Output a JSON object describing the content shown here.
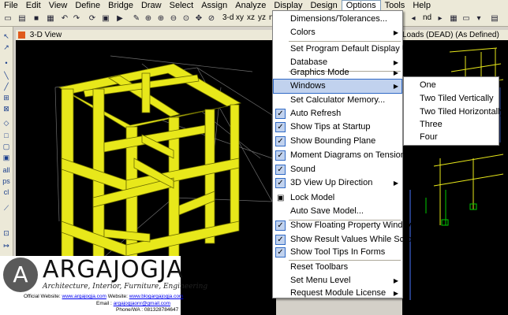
{
  "menu": [
    "File",
    "Edit",
    "View",
    "Define",
    "Bridge",
    "Draw",
    "Select",
    "Assign",
    "Analyze",
    "Display",
    "Design",
    "Options",
    "Tools",
    "Help"
  ],
  "active_menu": "Options",
  "toolbar": {
    "btn_3d": "3-d",
    "btn_xy": "xy",
    "btn_xz": "xz",
    "btn_yz": "yz",
    "btn_nv": "nv",
    "btn_nd": "nd"
  },
  "left_view": {
    "title": "3-D View"
  },
  "right_view": {
    "title": "Loads (DEAD) (As Defined)"
  },
  "options_menu": [
    {
      "label": "Dimensions/Tolerances...",
      "checked": false,
      "submenu": false
    },
    {
      "label": "Colors",
      "checked": false,
      "submenu": true
    },
    {
      "label": "Set Program Default Display Units...",
      "checked": false,
      "submenu": false
    },
    {
      "label": "Database",
      "checked": false,
      "submenu": true
    },
    {
      "label": "Graphics Mode",
      "checked": false,
      "submenu": true
    },
    {
      "label": "Windows",
      "checked": false,
      "submenu": true,
      "highlighted": true
    },
    {
      "label": "Set Calculator Memory...",
      "checked": false,
      "submenu": false
    },
    {
      "label": "Auto Refresh",
      "checked": true,
      "submenu": false
    },
    {
      "label": "Show Tips at Startup",
      "checked": true,
      "submenu": false
    },
    {
      "label": "Show Bounding Plane",
      "checked": true,
      "submenu": false
    },
    {
      "label": "Moment Diagrams on Tension Side",
      "checked": true,
      "submenu": false
    },
    {
      "label": "Sound",
      "checked": true,
      "submenu": false
    },
    {
      "label": "3D View Up Direction",
      "checked": true,
      "submenu": true
    },
    {
      "label": "Lock Model",
      "checked": false,
      "submenu": false,
      "icon": "lock-icon"
    },
    {
      "label": "Auto Save Model...",
      "checked": false,
      "submenu": false
    },
    {
      "label": "Show Floating Property Window",
      "checked": true,
      "submenu": false
    },
    {
      "label": "Show Result Values While Scrolling",
      "checked": true,
      "submenu": false
    },
    {
      "label": "Show Tool Tips In Forms",
      "checked": true,
      "submenu": false
    },
    {
      "label": "Reset Toolbars",
      "checked": false,
      "submenu": false
    },
    {
      "label": "Set Menu Level",
      "checked": false,
      "submenu": true
    },
    {
      "label": "Request Module License",
      "checked": false,
      "submenu": true
    }
  ],
  "windows_submenu": [
    "One",
    "Two Tiled Vertically",
    "Two Tiled Horizontally",
    "Three",
    "Four"
  ],
  "logo": {
    "letter": "A",
    "name": "ARGAJOGJA",
    "tagline": "Architecture, Interior, Furniture, Engineering",
    "official_label": "Official Website:",
    "official_url": "www.argajogja.com",
    "website_label": "Website:",
    "blog_url": "www.blogargajogja.com",
    "email_label": "Email :",
    "email": "argajogjaonr@gmail.com",
    "phone": "Phone/WA : 081328784647"
  },
  "colors": {
    "frame": "#e8e81a",
    "frame_edge": "#6a6a00",
    "menu_highlight": "#c1d2ee",
    "view_bg": "#000000"
  }
}
